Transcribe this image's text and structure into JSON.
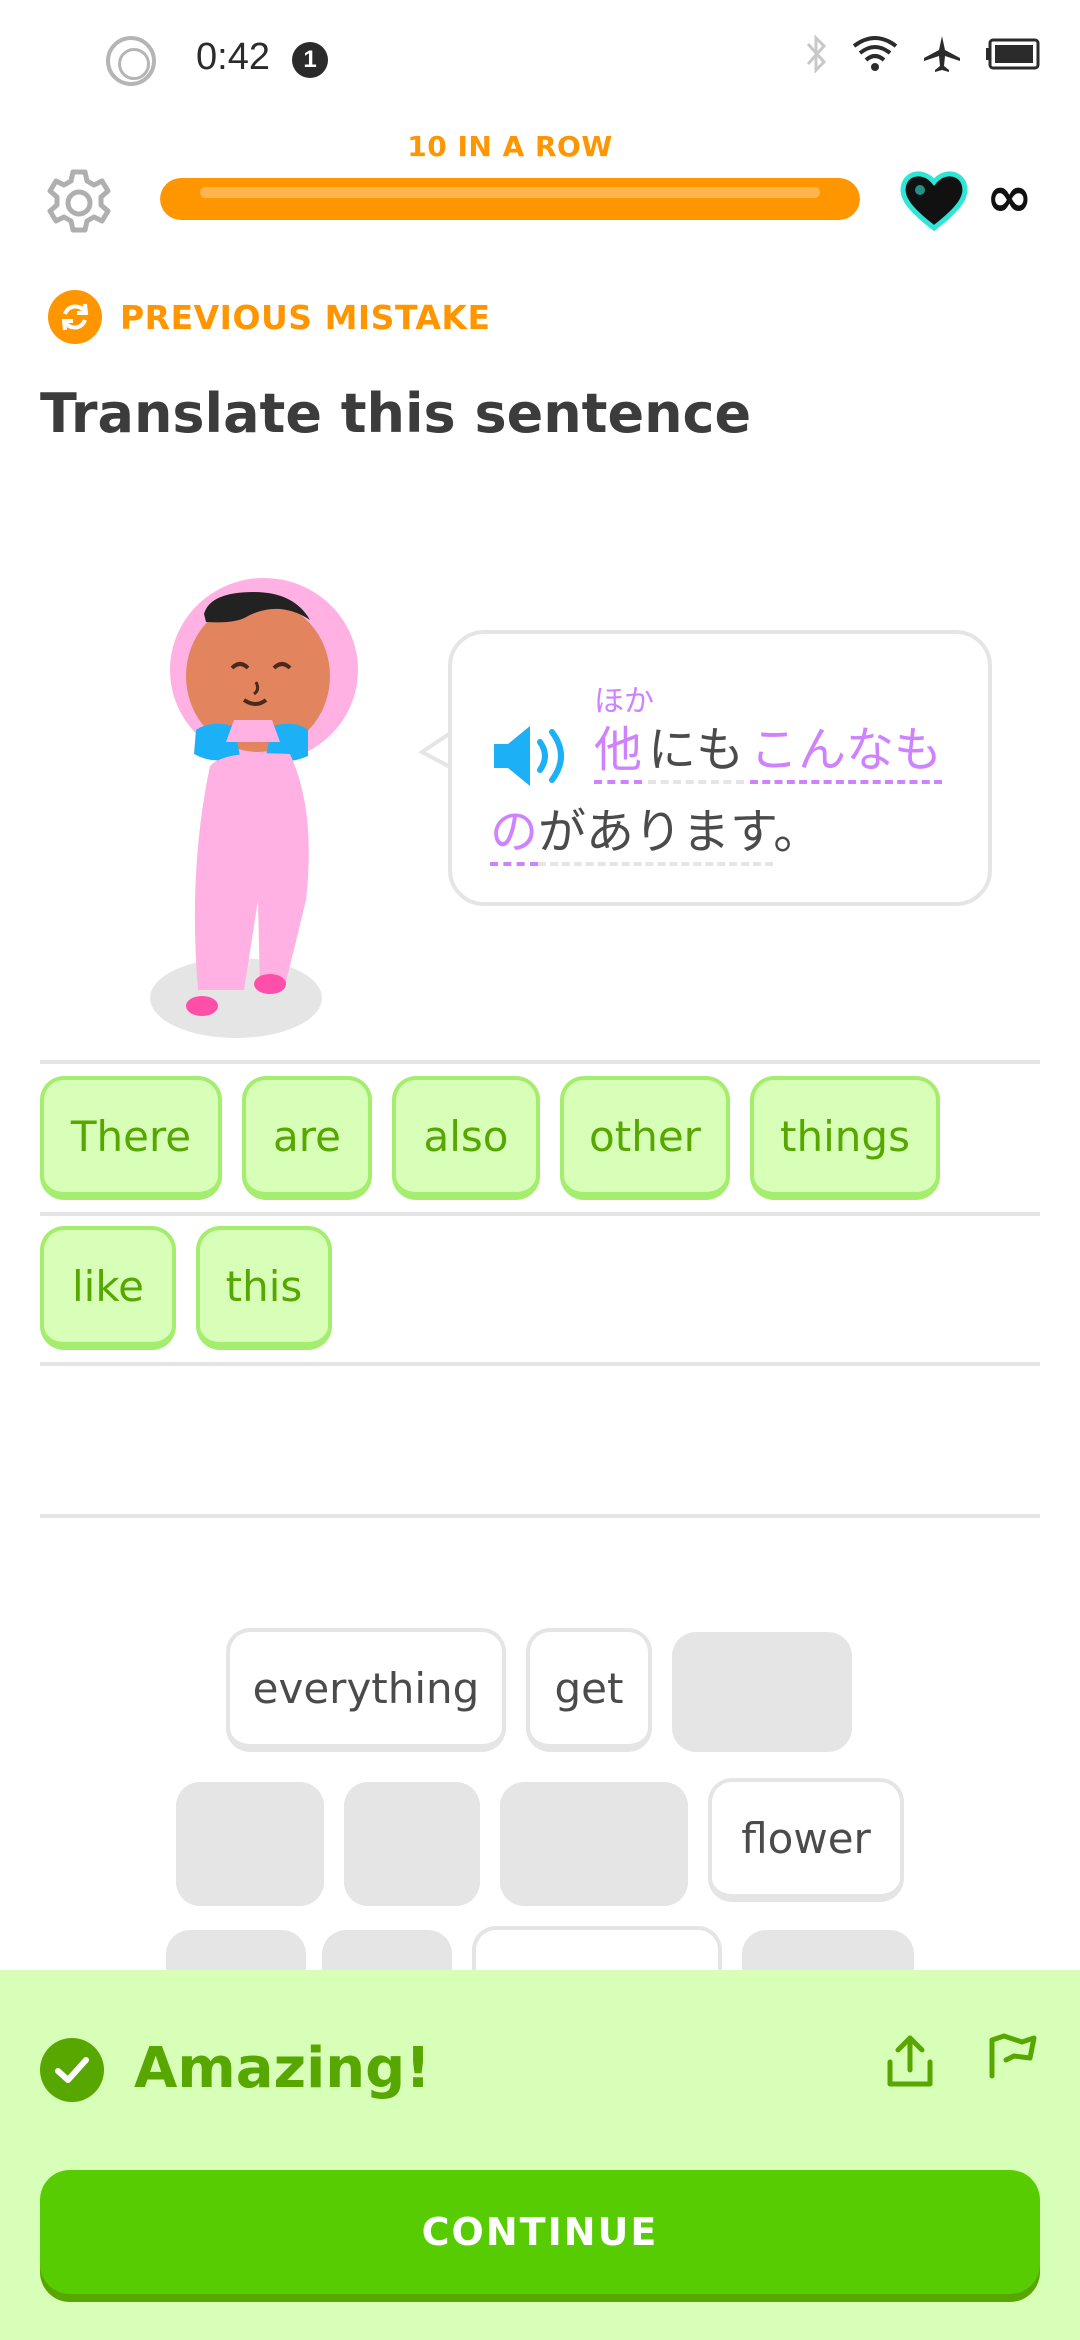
{
  "status_bar": {
    "time": "0:42",
    "notification_count": "1",
    "icons": [
      "bluetooth-icon",
      "wifi-icon",
      "airplane-icon",
      "battery-icon"
    ]
  },
  "header": {
    "streak_label": "10 IN A ROW",
    "progress": 1.0,
    "hearts": "∞",
    "accent_color": "#ff9600"
  },
  "prompt": {
    "tag": "PREVIOUS MISTAKE",
    "title": "Translate this sentence"
  },
  "sentence": {
    "furigana": "ほか",
    "line1": [
      {
        "text": "他",
        "style": "hl"
      },
      {
        "text": "にも",
        "style": "plain"
      },
      {
        "text": "こんなも",
        "style": "hl"
      }
    ],
    "line2": [
      {
        "text": "の",
        "style": "hl"
      },
      {
        "text": "があります",
        "style": "plain"
      },
      {
        "text": "。",
        "style": "none"
      }
    ]
  },
  "answer": {
    "chips": [
      "There",
      "are",
      "also",
      "other",
      "things",
      "like",
      "this"
    ]
  },
  "word_bank": {
    "visible_words": [
      "everything",
      "get",
      "flower"
    ]
  },
  "feedback": {
    "title": "Amazing!",
    "button": "CONTINUE",
    "color": "#58cc02"
  }
}
